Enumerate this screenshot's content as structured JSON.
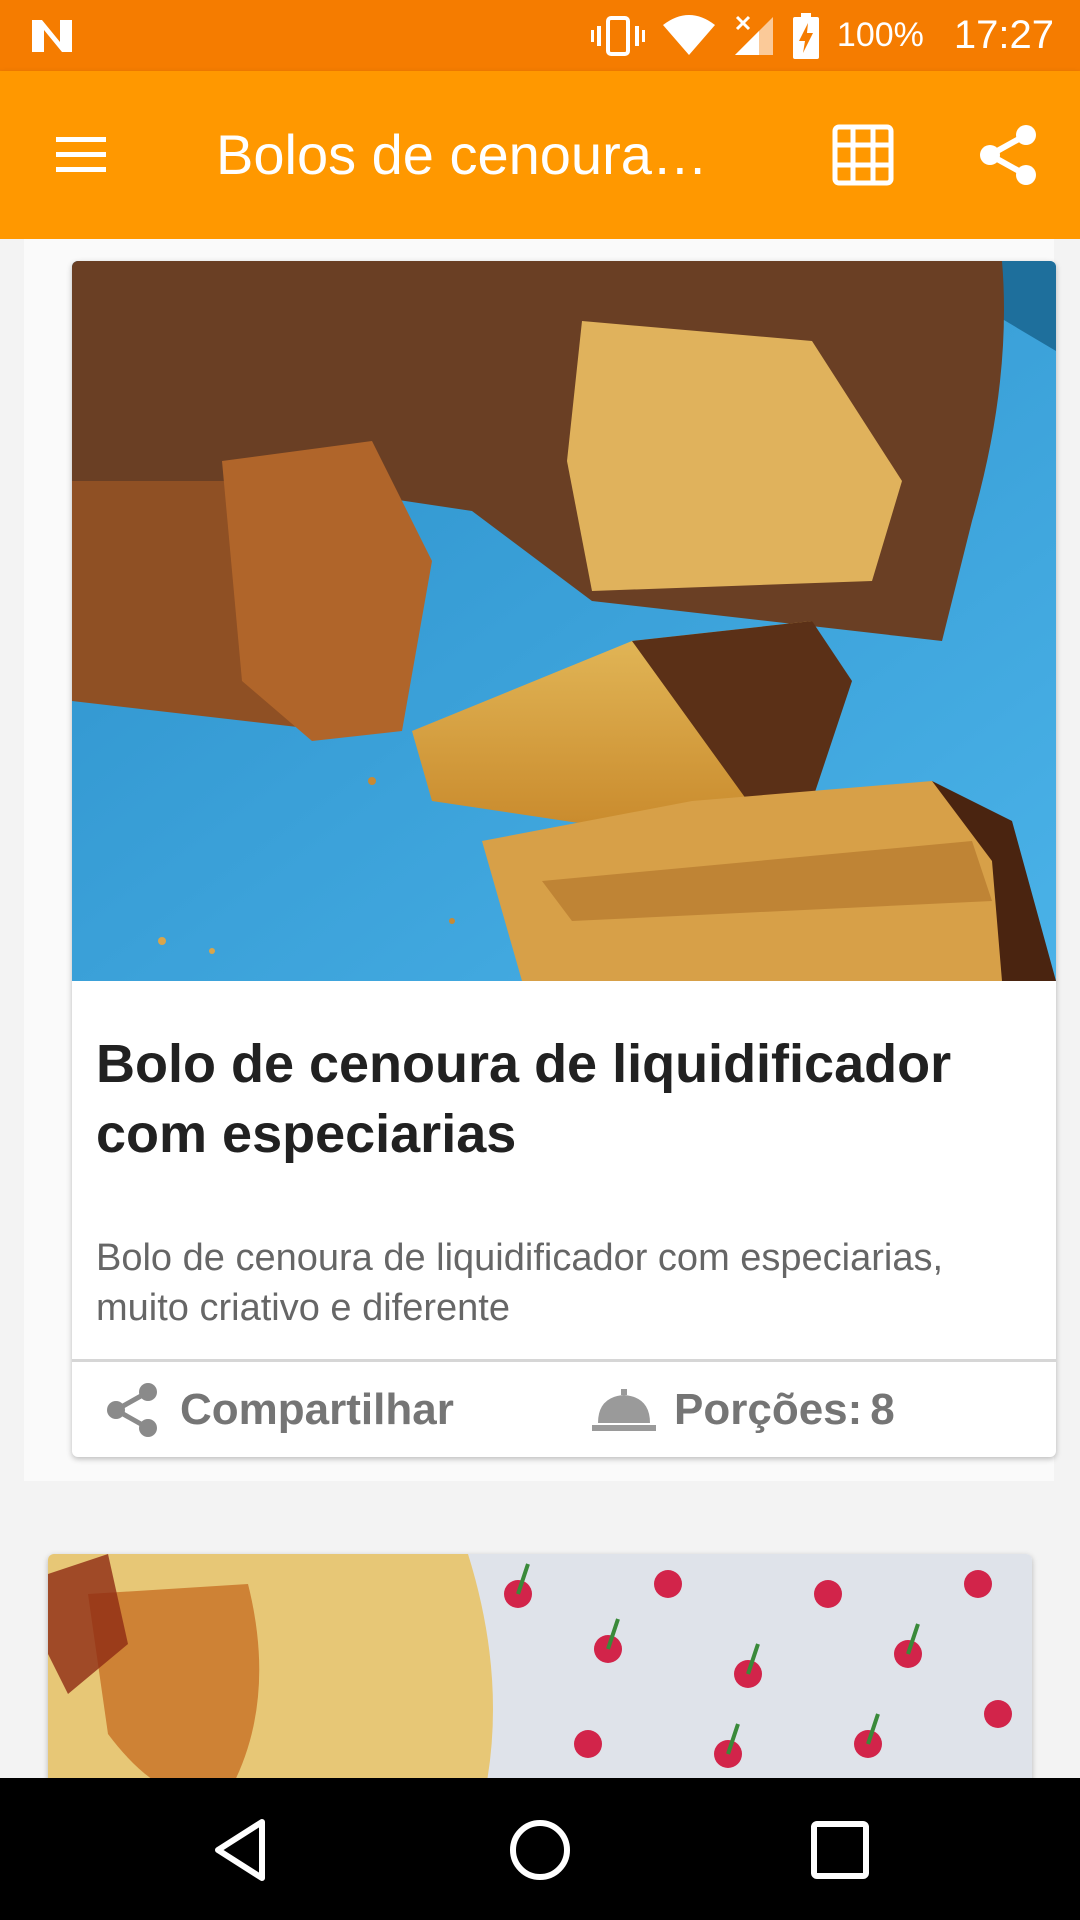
{
  "status_bar": {
    "battery_percent": "100%",
    "time": "17:27",
    "icons": [
      "notification-n-icon",
      "vibrate-icon",
      "wifi-icon",
      "signal-icon",
      "battery-charging-icon"
    ]
  },
  "app_bar": {
    "title": "Bolos de cenoura…",
    "menu_icon": "hamburger-menu-icon",
    "grid_icon": "grid-view-icon",
    "share_icon": "share-icon"
  },
  "recipes": [
    {
      "title": "Bolo de cenoura de liquidificador com especiarias",
      "description": "Bolo de cenoura de liquidificador com especiarias, muito criativo e diferente",
      "share_label": "Compartilhar",
      "portions_label": "Porções:",
      "portions_value": "8"
    }
  ],
  "colors": {
    "status_bar": "#f57c00",
    "app_bar": "#ff9800",
    "card_bg": "#ffffff",
    "nav_bar": "#000000"
  },
  "nav_bar": {
    "icons": [
      "back-icon",
      "home-icon",
      "recents-icon"
    ]
  }
}
